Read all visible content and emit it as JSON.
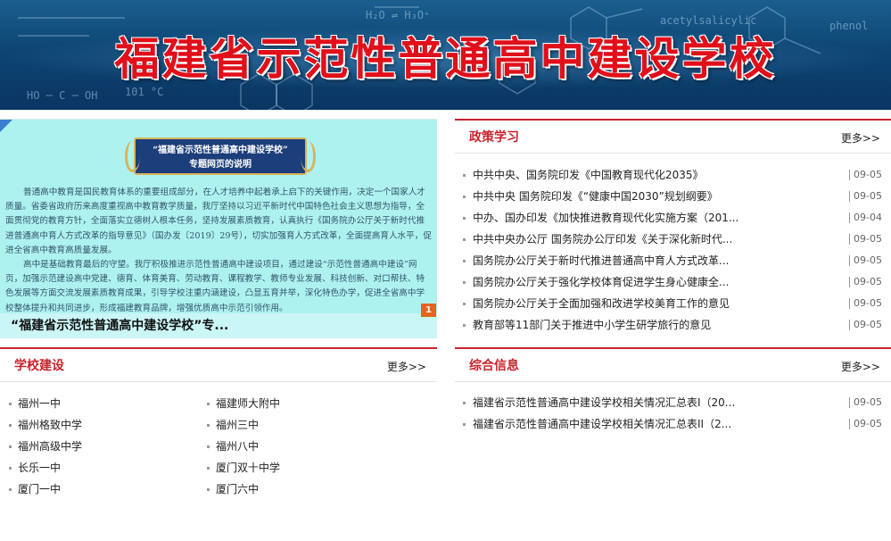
{
  "banner": {
    "title": "福建省示范性普通高中建设学校"
  },
  "slide": {
    "doc_title_line1": "“福建省示范性普通高中建设学校”",
    "doc_title_line2": "专题网页的说明",
    "doc_paragraph1": "普通高中教育是国民教育体系的重要组成部分，在人才培养中起着承上启下的关键作用，决定一个国家人才质量。省委省政府历来高度重视高中教育教学质量，我厅坚持以习近平新时代中国特色社会主义思想为指导，全面贯彻党的教育方针，全面落实立德树人根本任务，坚持发展素质教育，认真执行《国务院办公厅关于新时代推进普通高中育人方式改革的指导意见》（国办发〔2019〕29号），切实加强育人方式改革，全面提高育人水平，促进全省高中教育高质量发展。",
    "doc_paragraph2": "高中是基础教育最后的守望。我厅积极推进示范性普通高中建设项目，通过建设“示范性普通高中建设”网页，加强示范建设高中党建、德育、体育美育、劳动教育、课程教学、教师专业发展、科技创新、对口帮扶、特色发展等方面交流发展素质教育成果，引导学校注重内涵建设，凸显五育并举，深化特色办学，促进全省高中学校整体提升和共同进步，形成福建教育品牌，增强优质高中示范引领作用。",
    "caption": "“福建省示范性普通高中建设学校”专...",
    "slide_number": "1"
  },
  "policy": {
    "title": "政策学习",
    "more": "更多>>",
    "items": [
      {
        "title": "中共中央、国务院印发《中国教育现代化2035》",
        "date": "09-05"
      },
      {
        "title": "中共中央 国务院印发《“健康中国2030”规划纲要》",
        "date": "09-05"
      },
      {
        "title": "中办、国办印发《加快推进教育现代化实施方案（201...",
        "date": "09-04"
      },
      {
        "title": "中共中央办公厅 国务院办公厅印发《关于深化新时代...",
        "date": "09-05"
      },
      {
        "title": "国务院办公厅关于新时代推进普通高中育人方式改革...",
        "date": "09-05"
      },
      {
        "title": "国务院办公厅关于强化学校体育促进学生身心健康全...",
        "date": "09-05"
      },
      {
        "title": "国务院办公厅关于全面加强和改进学校美育工作的意见",
        "date": "09-05"
      },
      {
        "title": "教育部等11部门关于推进中小学生研学旅行的意见",
        "date": "09-05"
      }
    ]
  },
  "schools": {
    "title": "学校建设",
    "more": "更多>>",
    "items": [
      "福州一中",
      "福建师大附中",
      "福州格致中学",
      "福州三中",
      "福州高级中学",
      "福州八中",
      "长乐一中",
      "厦门双十中学",
      "厦门一中",
      "厦门六中"
    ]
  },
  "info": {
    "title": "综合信息",
    "more": "更多>>",
    "items": [
      {
        "title": "福建省示范性普通高中建设学校相关情况汇总表I（20...",
        "date": "09-05"
      },
      {
        "title": "福建省示范性普通高中建设学校相关情况汇总表II（2...",
        "date": "09-05"
      }
    ]
  }
}
